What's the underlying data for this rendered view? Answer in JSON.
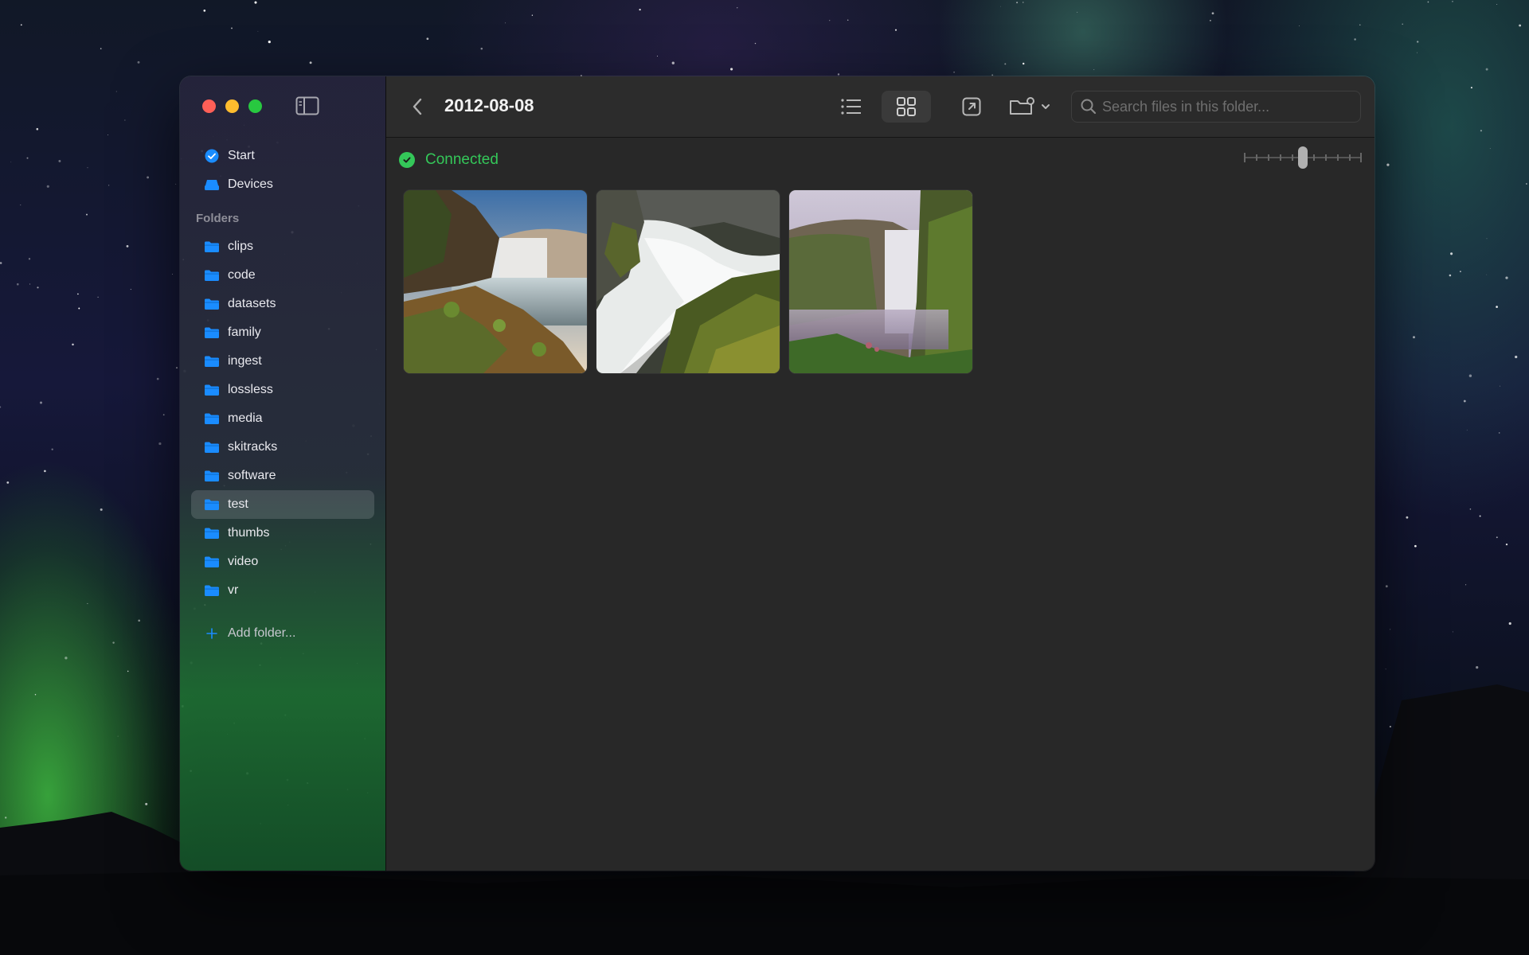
{
  "window": {
    "traffic_lights": {
      "close": "#fe5f57",
      "minimize": "#febc2e",
      "zoom": "#28c840"
    }
  },
  "sidebar": {
    "top_items": [
      {
        "label": "Start",
        "icon": "checkmark-badge-icon"
      },
      {
        "label": "Devices",
        "icon": "devices-icon"
      }
    ],
    "folders_label": "Folders",
    "folders": [
      {
        "label": "clips"
      },
      {
        "label": "code"
      },
      {
        "label": "datasets"
      },
      {
        "label": "family"
      },
      {
        "label": "ingest"
      },
      {
        "label": "lossless"
      },
      {
        "label": "media"
      },
      {
        "label": "skitracks"
      },
      {
        "label": "software"
      },
      {
        "label": "test",
        "selected": true
      },
      {
        "label": "thumbs"
      },
      {
        "label": "video"
      },
      {
        "label": "vr"
      }
    ],
    "add_folder_label": "Add folder..."
  },
  "toolbar": {
    "title": "2012-08-08",
    "view_mode": "grid",
    "search_placeholder": "Search files in this folder...",
    "search_value": ""
  },
  "status": {
    "label": "Connected",
    "color": "#34c759"
  },
  "thumbnails": [
    {
      "name": "waterfall-thumbnail-1"
    },
    {
      "name": "waterfall-thumbnail-2"
    },
    {
      "name": "waterfall-thumbnail-3"
    }
  ],
  "colors": {
    "accent_blue": "#1a8cff",
    "connected_green": "#34c759"
  }
}
